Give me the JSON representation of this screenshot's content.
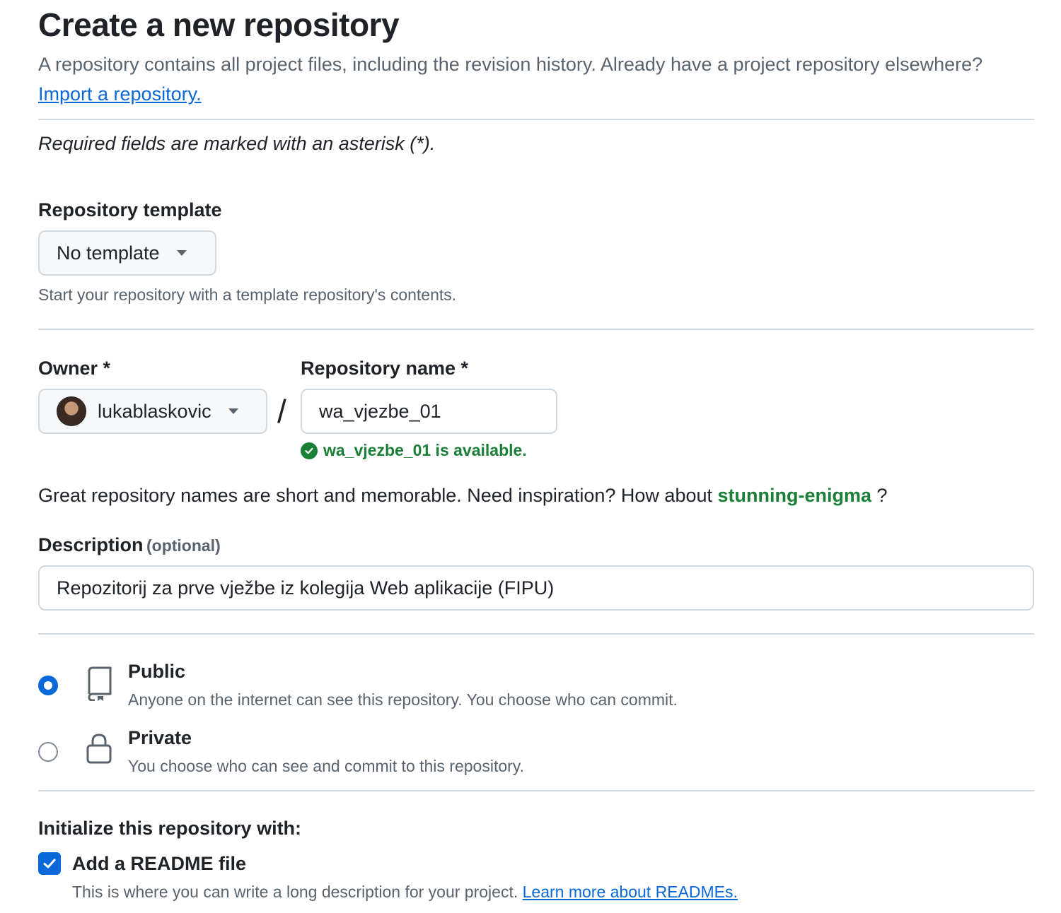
{
  "header": {
    "title": "Create a new repository",
    "subtitle": "A repository contains all project files, including the revision history. Already have a project repository elsewhere?",
    "import_link": "Import a repository."
  },
  "required_note": "Required fields are marked with an asterisk (*).",
  "template": {
    "label": "Repository template",
    "selected": "No template",
    "hint": "Start your repository with a template repository's contents."
  },
  "owner": {
    "label": "Owner *",
    "selected": "lukablaskovic"
  },
  "separator": "/",
  "repo_name": {
    "label": "Repository name *",
    "value": "wa_vjezbe_01",
    "availability": "wa_vjezbe_01 is available."
  },
  "suggestion": {
    "text_before": "Great repository names are short and memorable. Need inspiration? How about",
    "name": "stunning-enigma",
    "text_after": "?"
  },
  "description": {
    "label": "Description",
    "optional": "(optional)",
    "value": "Repozitorij za prve vježbe iz kolegija Web aplikacije (FIPU)"
  },
  "visibility": {
    "selected": "Public",
    "options": [
      {
        "title": "Public",
        "desc": "Anyone on the internet can see this repository. You choose who can commit.",
        "icon": "repo-icon"
      },
      {
        "title": "Private",
        "desc": "You choose who can see and commit to this repository.",
        "icon": "lock-icon"
      }
    ]
  },
  "initialize": {
    "heading": "Initialize this repository with:",
    "readme_label": "Add a README file",
    "readme_checked": true,
    "readme_desc": "This is where you can write a long description for your project.",
    "readme_link": "Learn more about READMEs."
  },
  "colors": {
    "accent": "#0969da",
    "success": "#1a7f37",
    "muted": "#59636e",
    "border": "#d1d9e0"
  }
}
